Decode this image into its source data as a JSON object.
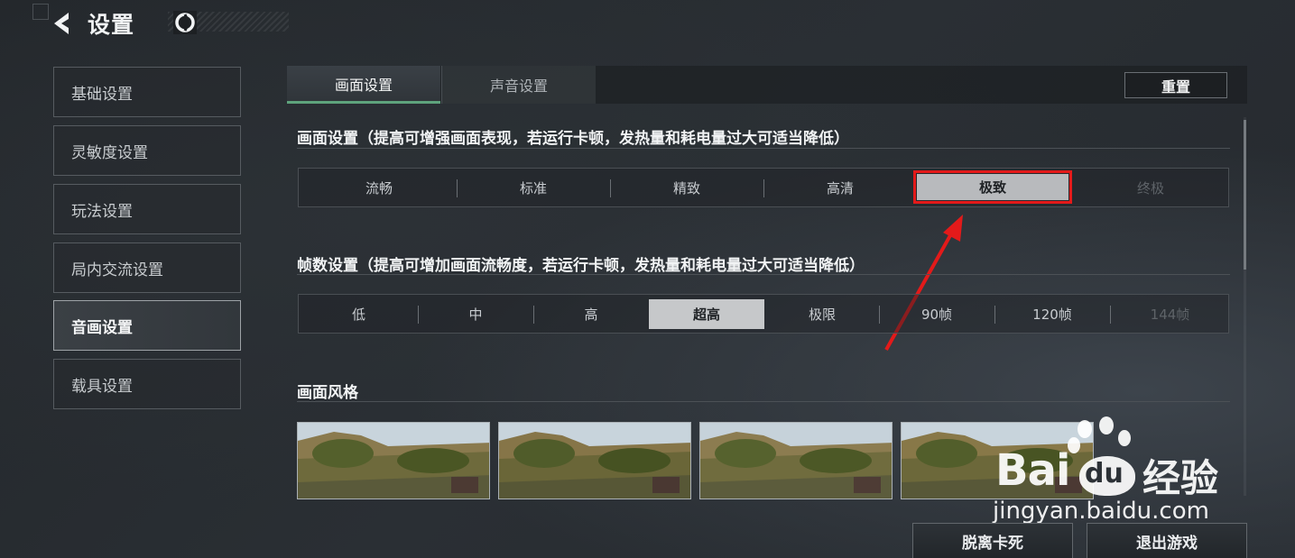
{
  "header": {
    "title": "设置",
    "back_icon": "back-arrow-icon",
    "settings_icon": "circle-logo-icon"
  },
  "sidebar": {
    "items": [
      {
        "label": "基础设置",
        "active": false
      },
      {
        "label": "灵敏度设置",
        "active": false
      },
      {
        "label": "玩法设置",
        "active": false
      },
      {
        "label": "局内交流设置",
        "active": false
      },
      {
        "label": "音画设置",
        "active": true
      },
      {
        "label": "载具设置",
        "active": false
      }
    ]
  },
  "tabs": {
    "items": [
      {
        "label": "画面设置",
        "active": true
      },
      {
        "label": "声音设置",
        "active": false
      }
    ],
    "reset_label": "重置"
  },
  "graphics_quality": {
    "title": "画面设置（提高可增强画面表现，若运行卡顿，发热量和耗电量过大可适当降低）",
    "options": [
      "流畅",
      "标准",
      "精致",
      "高清",
      "极致",
      "终极"
    ],
    "selected": "极致",
    "disabled": [
      "终极"
    ]
  },
  "frame_rate": {
    "title": "帧数设置（提高可增加画面流畅度，若运行卡顿，发热量和耗电量过大可适当降低）",
    "options": [
      "低",
      "中",
      "高",
      "超高",
      "极限",
      "90帧",
      "120帧",
      "144帧"
    ],
    "selected": "超高",
    "disabled": [
      "144帧"
    ]
  },
  "style": {
    "title": "画面风格",
    "thumbnail_count": 4
  },
  "bottom_buttons": {
    "unstuck": "脱离卡死",
    "exit": "退出游戏"
  },
  "watermark": {
    "brand_left": "Bai",
    "brand_mid": "du",
    "brand_right": "经验",
    "url": "jingyan.baidu.com"
  },
  "colors": {
    "accent_green": "#5ea37c",
    "annotation_red": "#e31a1a",
    "selected_bg": "#c6c8ca"
  }
}
